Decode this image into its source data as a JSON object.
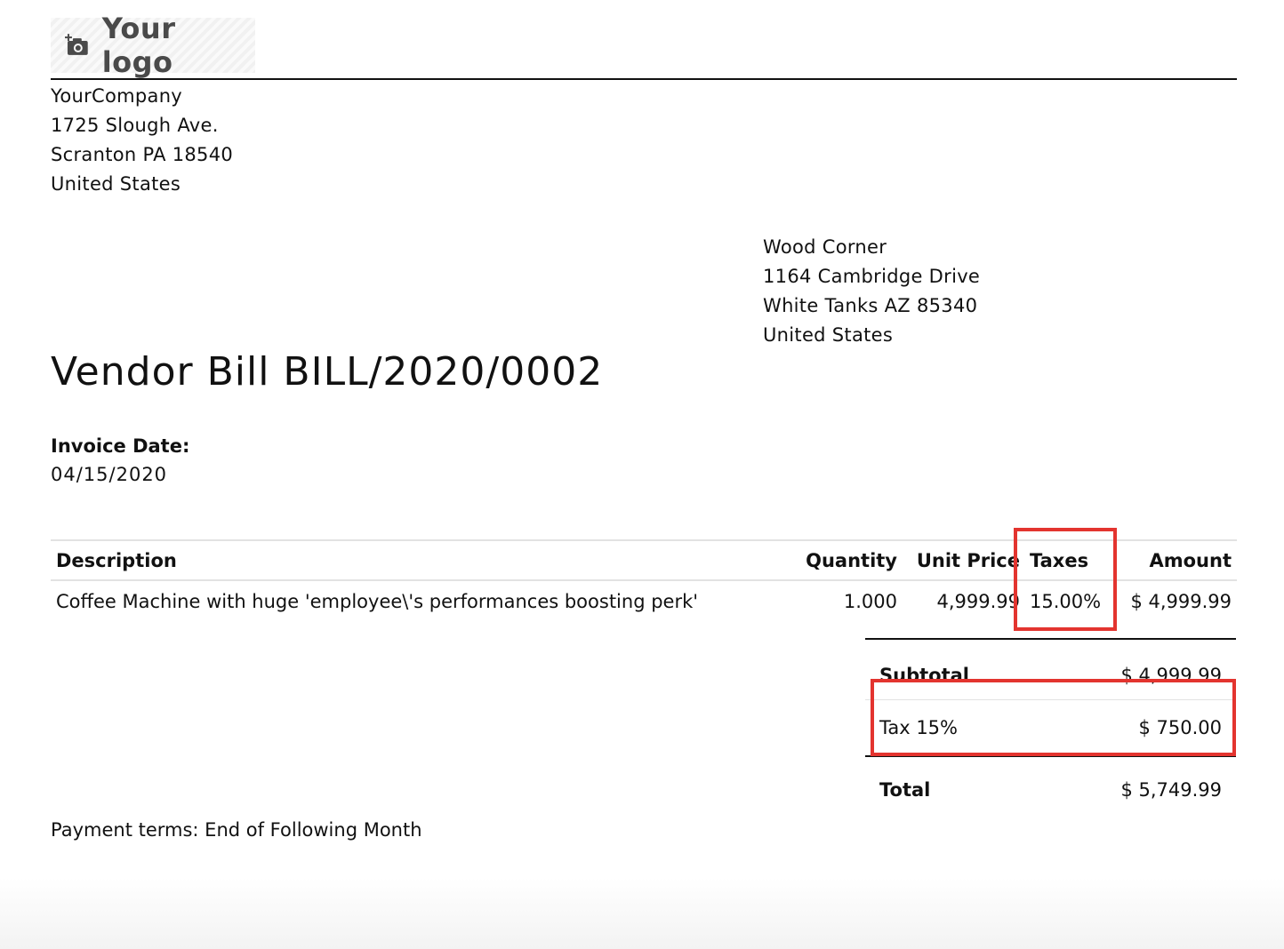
{
  "logo": {
    "text": "Your logo",
    "icon": "camera-add-icon"
  },
  "company": {
    "name": "YourCompany",
    "street": "1725 Slough Ave.",
    "city_line": "Scranton PA 18540",
    "country": "United States"
  },
  "vendor": {
    "name": "Wood Corner",
    "street": "1164 Cambridge Drive",
    "city_line": "White Tanks AZ 85340",
    "country": "United States"
  },
  "bill": {
    "title": "Vendor Bill BILL/2020/0002",
    "date_label": "Invoice Date:",
    "date_value": "04/15/2020"
  },
  "lines": {
    "headers": {
      "description": "Description",
      "quantity": "Quantity",
      "unit_price": "Unit Price",
      "taxes": "Taxes",
      "amount": "Amount"
    },
    "rows": [
      {
        "description": "Coffee Machine with huge 'employee\\'s performances boosting perk'",
        "quantity": "1.000",
        "unit_price": "4,999.99",
        "taxes": "15.00%",
        "amount": "$ 4,999.99"
      }
    ]
  },
  "totals": {
    "subtotal_label": "Subtotal",
    "subtotal_value": "$ 4,999.99",
    "tax_label": "Tax 15%",
    "tax_value": "$ 750.00",
    "total_label": "Total",
    "total_value": "$ 5,749.99"
  },
  "payment_terms": "Payment terms: End of Following Month",
  "colors": {
    "highlight": "#e3342f",
    "text": "#111111",
    "logo_text": "#4a4a4a"
  }
}
